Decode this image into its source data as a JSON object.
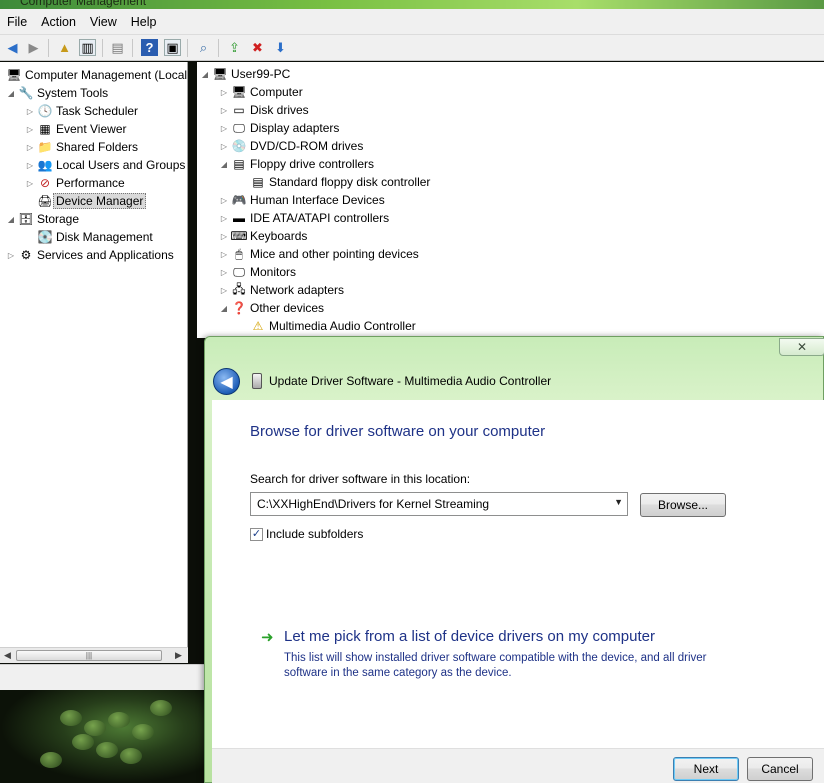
{
  "window": {
    "title": "Computer Management"
  },
  "menubar": [
    "File",
    "Action",
    "View",
    "Help"
  ],
  "left_tree": [
    {
      "label": "Computer Management (Local",
      "icon": "computer-management-icon",
      "glyph": "🖥",
      "expander": "",
      "indent": 0
    },
    {
      "label": "System Tools",
      "icon": "tools-icon",
      "glyph": "🔧",
      "expander": "◢",
      "indent": 1
    },
    {
      "label": "Task Scheduler",
      "icon": "clock-icon",
      "glyph": "🕓",
      "expander": "▷",
      "indent": 2
    },
    {
      "label": "Event Viewer",
      "icon": "event-viewer-icon",
      "glyph": "▦",
      "expander": "▷",
      "indent": 2
    },
    {
      "label": "Shared Folders",
      "icon": "shared-folder-icon",
      "glyph": "📁",
      "expander": "▷",
      "indent": 2
    },
    {
      "label": "Local Users and Groups",
      "icon": "users-icon",
      "glyph": "👥",
      "expander": "▷",
      "indent": 2
    },
    {
      "label": "Performance",
      "icon": "performance-icon",
      "glyph": "⊘",
      "expander": "▷",
      "indent": 2
    },
    {
      "label": "Device Manager",
      "icon": "device-manager-icon",
      "glyph": "🖨",
      "expander": "",
      "indent": 2,
      "selected": true
    },
    {
      "label": "Storage",
      "icon": "storage-icon",
      "glyph": "🗄",
      "expander": "◢",
      "indent": 1
    },
    {
      "label": "Disk Management",
      "icon": "disk-icon",
      "glyph": "💽",
      "expander": "",
      "indent": 2
    },
    {
      "label": "Services and Applications",
      "icon": "services-icon",
      "glyph": "⚙",
      "expander": "▷",
      "indent": 1
    }
  ],
  "device_tree": [
    {
      "label": "User99-PC",
      "icon": "computer-icon",
      "glyph": "🖥",
      "expander": "◢",
      "indent": 0
    },
    {
      "label": "Computer",
      "icon": "computer-icon",
      "glyph": "🖥",
      "expander": "▷",
      "indent": 1
    },
    {
      "label": "Disk drives",
      "icon": "disk-drive-icon",
      "glyph": "▭",
      "expander": "▷",
      "indent": 1
    },
    {
      "label": "Display adapters",
      "icon": "display-adapter-icon",
      "glyph": "🖵",
      "expander": "▷",
      "indent": 1
    },
    {
      "label": "DVD/CD-ROM drives",
      "icon": "dvd-drive-icon",
      "glyph": "💿",
      "expander": "▷",
      "indent": 1
    },
    {
      "label": "Floppy drive controllers",
      "icon": "floppy-controller-icon",
      "glyph": "▤",
      "expander": "◢",
      "indent": 1
    },
    {
      "label": "Standard floppy disk controller",
      "icon": "floppy-controller-icon",
      "glyph": "▤",
      "expander": "",
      "indent": 2
    },
    {
      "label": "Human Interface Devices",
      "icon": "hid-icon",
      "glyph": "🎮",
      "expander": "▷",
      "indent": 1
    },
    {
      "label": "IDE ATA/ATAPI controllers",
      "icon": "ide-controller-icon",
      "glyph": "▬",
      "expander": "▷",
      "indent": 1
    },
    {
      "label": "Keyboards",
      "icon": "keyboard-icon",
      "glyph": "⌨",
      "expander": "▷",
      "indent": 1
    },
    {
      "label": "Mice and other pointing devices",
      "icon": "mouse-icon",
      "glyph": "🖱",
      "expander": "▷",
      "indent": 1
    },
    {
      "label": "Monitors",
      "icon": "monitor-icon",
      "glyph": "🖵",
      "expander": "▷",
      "indent": 1
    },
    {
      "label": "Network adapters",
      "icon": "network-adapter-icon",
      "glyph": "🖧",
      "expander": "▷",
      "indent": 1
    },
    {
      "label": "Other devices",
      "icon": "unknown-device-icon",
      "glyph": "❓",
      "expander": "◢",
      "indent": 1
    },
    {
      "label": "Multimedia Audio Controller",
      "icon": "warning-icon",
      "glyph": "⚠",
      "expander": "",
      "indent": 2
    }
  ],
  "dialog": {
    "title": "Update Driver Software - Multimedia Audio Controller",
    "heading": "Browse for driver software on your computer",
    "search_label": "Search for driver software in this location:",
    "path_value": "C:\\XXHighEnd\\Drivers for Kernel Streaming",
    "browse_label": "Browse...",
    "include_subfolders_label": "Include subfolders",
    "include_subfolders_checked": true,
    "pick_link": "Let me pick from a list of device drivers on my computer",
    "pick_description": "This list will show installed driver software compatible with the device, and all driver software in the same category as the device.",
    "next_label": "Next",
    "cancel_label": "Cancel",
    "close_glyph": "✕"
  },
  "colors": {
    "dialog_chrome": "#c8ecb8",
    "link_blue": "#1e3287",
    "arrow_green": "#2aa12a"
  }
}
